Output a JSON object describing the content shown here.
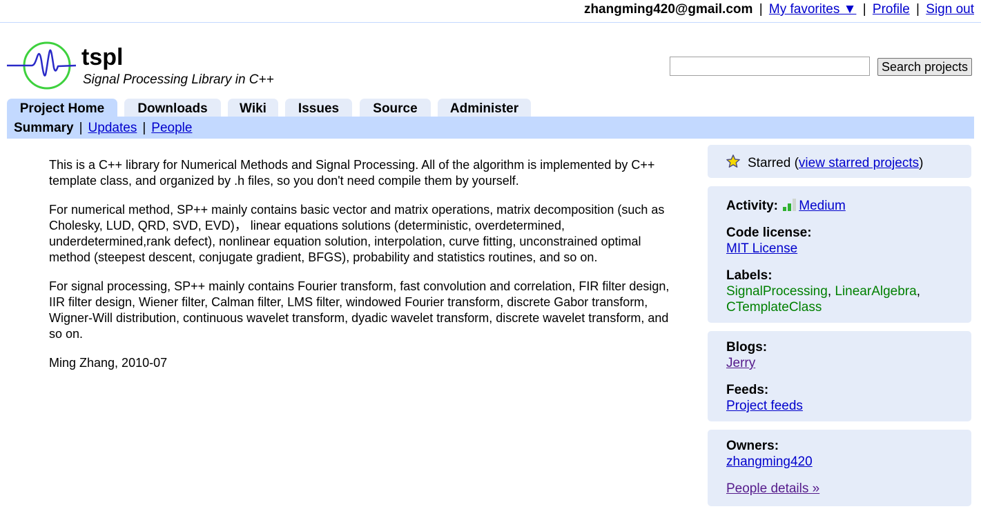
{
  "userbar": {
    "email": "zhangming420@gmail.com",
    "favorites": "My favorites ▼",
    "profile": "Profile",
    "signout": "Sign out",
    "separator": "|"
  },
  "header": {
    "name": "tspl",
    "summary": "Signal Processing Library in C++",
    "search_button": "Search projects",
    "search_value": ""
  },
  "tabs": [
    {
      "label": "Project Home",
      "active": true
    },
    {
      "label": "Downloads"
    },
    {
      "label": "Wiki"
    },
    {
      "label": "Issues"
    },
    {
      "label": "Source"
    },
    {
      "label": "Administer"
    }
  ],
  "subnav": {
    "current": "Summary",
    "updates": "Updates",
    "people": "People",
    "separator": "|"
  },
  "description": [
    "This is a C++ library for Numerical Methods and Signal Processing. All of the algorithm is implemented by C++ template class, and organized by .h files, so you don't need compile them by yourself.",
    "For numerical method, SP++ mainly contains basic vector and matrix operations, matrix decomposition (such as Cholesky, LUD, QRD, SVD, EVD)，  linear equations solutions (deterministic, overdetermined, underdetermined,rank defect), nonlinear equation solution, interpolation, curve fitting, unconstrained optimal method (steepest descent, conjugate gradient, BFGS), probability and statistics routines, and so on.",
    "For signal processing, SP++ mainly contains Fourier transform, fast convolution and correlation, FIR filter design, IIR filter design, Wiener filter, Calman filter, LMS filter, windowed Fourier transform, discrete Gabor transform, Wigner-Will distribution, continuous wavelet transform, dyadic wavelet transform, discrete wavelet transform, and so on.",
    "Ming Zhang, 2010-07"
  ],
  "sidebar": {
    "star": {
      "starred": "Starred (",
      "link": "view starred projects",
      "close": ")"
    },
    "activity": {
      "label": "Activity:",
      "value": "Medium"
    },
    "license": {
      "label": "Code license:",
      "value": "MIT License"
    },
    "labels": {
      "label": "Labels:",
      "items": [
        "SignalProcessing",
        "LinearAlgebra",
        "CTemplateClass"
      ],
      "separator": ","
    },
    "blogs": {
      "label": "Blogs:",
      "value": "Jerry"
    },
    "feeds": {
      "label": "Feeds:",
      "value": "Project feeds"
    },
    "owners": {
      "label": "Owners:",
      "value": "zhangming420"
    },
    "people_details": "People details »"
  },
  "colors": {
    "tab_bg": "#e5ecf9",
    "tab_active": "#c3d9ff",
    "link": "#0000cc",
    "visited": "#551a8b",
    "label_green": "#008000",
    "star": "#f5d800"
  }
}
